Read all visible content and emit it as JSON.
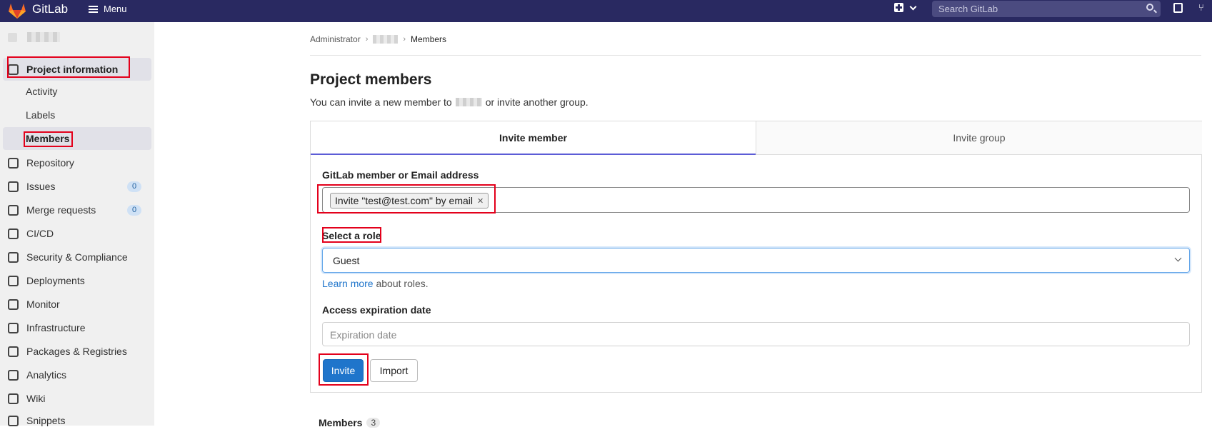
{
  "topbar": {
    "brand": "GitLab",
    "menu_label": "Menu",
    "search_placeholder": "Search GitLab"
  },
  "sidebar": {
    "project_info": "Project information",
    "sub_items": [
      "Activity",
      "Labels",
      "Members"
    ],
    "items": [
      {
        "label": "Repository",
        "icon": "repository-icon"
      },
      {
        "label": "Issues",
        "icon": "issues-icon",
        "count": "0"
      },
      {
        "label": "Merge requests",
        "icon": "merge-request-icon",
        "count": "0"
      },
      {
        "label": "CI/CD",
        "icon": "rocket-icon"
      },
      {
        "label": "Security & Compliance",
        "icon": "shield-icon"
      },
      {
        "label": "Deployments",
        "icon": "deployments-icon"
      },
      {
        "label": "Monitor",
        "icon": "monitor-icon"
      },
      {
        "label": "Infrastructure",
        "icon": "cloud-icon"
      },
      {
        "label": "Packages & Registries",
        "icon": "package-icon"
      },
      {
        "label": "Analytics",
        "icon": "chart-icon"
      },
      {
        "label": "Wiki",
        "icon": "book-icon"
      },
      {
        "label": "Snippets",
        "icon": "scissors-icon"
      }
    ]
  },
  "breadcrumb": {
    "root": "Administrator",
    "current": "Members"
  },
  "page": {
    "title": "Project members",
    "desc_before": "You can invite a new member to",
    "desc_after": "or invite another group."
  },
  "tabs": {
    "invite_member": "Invite member",
    "invite_group": "Invite group"
  },
  "form": {
    "member_label": "GitLab member or Email address",
    "token_text": "Invite \"test@test.com\" by email",
    "role_label": "Select a role",
    "role_value": "Guest",
    "learn_more": "Learn more",
    "about_roles": " about roles.",
    "expiration_label": "Access expiration date",
    "expiration_placeholder": "Expiration date",
    "invite_button": "Invite",
    "import_button": "Import"
  },
  "members": {
    "heading": "Members",
    "count": "3"
  },
  "colors": {
    "topbar": "#292961",
    "primary": "#1f75cb",
    "highlight": "#e3001b"
  }
}
